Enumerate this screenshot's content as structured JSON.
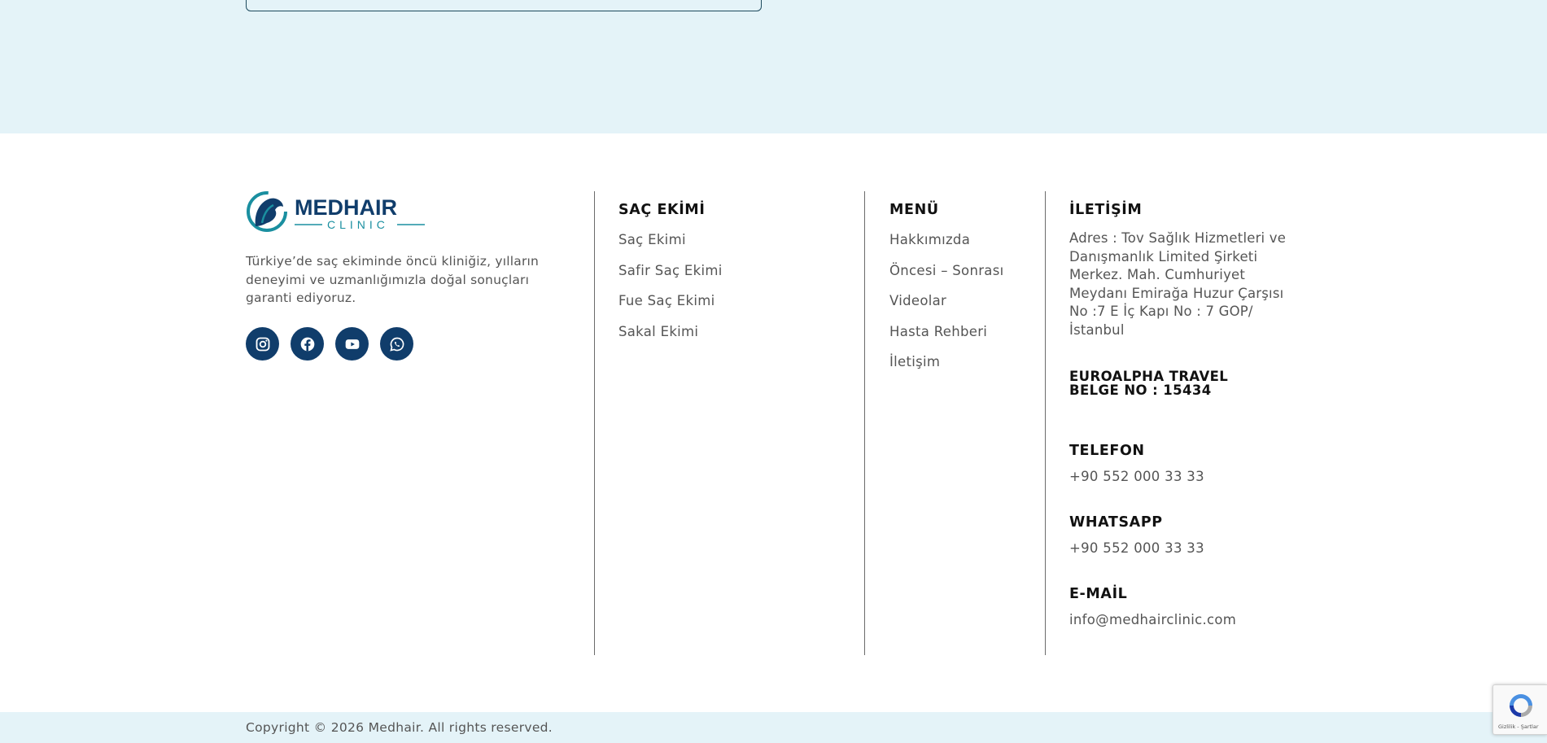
{
  "brand": {
    "name_top": "MEDHAIR",
    "name_bottom": "CLINIC",
    "tagline": "Türkiye’de saç ekiminde öncü kliniğiz, yılların deneyimi ve uzmanlığımızla doğal sonuçları garanti ediyoruz.",
    "accent_color": "#103d6b",
    "logo_teal": "#1a8fa0"
  },
  "socials": [
    {
      "name": "instagram",
      "icon": "instagram-icon"
    },
    {
      "name": "facebook",
      "icon": "facebook-icon"
    },
    {
      "name": "youtube",
      "icon": "youtube-icon"
    },
    {
      "name": "whatsapp",
      "icon": "whatsapp-icon"
    }
  ],
  "columns": {
    "hair": {
      "title": "SAÇ EKİMİ",
      "links": [
        "Saç Ekimi",
        "Safir Saç Ekimi",
        "Fue Saç Ekimi",
        "Sakal Ekimi"
      ]
    },
    "menu": {
      "title": "MENÜ",
      "links": [
        "Hakkımızda",
        "Öncesi – Sonrası",
        "Videolar",
        "Hasta Rehberi",
        "İletişim"
      ]
    }
  },
  "contact": {
    "title": "İLETİŞİM",
    "address": "Adres : Tov Sağlık Hizmetleri ve Danışmanlık Limited Şirketi Merkez. Mah. Cumhuriyet Meydanı Emirağa Huzur Çarşısı No :7 E İç Kapı No : 7 GOP/ İstanbul",
    "belge": "EUROALPHA TRAVEL BELGE NO : 15434",
    "phone_label": "TELEFON",
    "phone": "+90 552 000 33 33",
    "whatsapp_label": "WHATSAPP",
    "whatsapp": "+90 552 000 33 33",
    "email_label": "E-MAİL",
    "email": "info@medhairclinic.com"
  },
  "copyright": "Copyright © 2026 Medhair. All rights reserved.",
  "recaptcha": {
    "text": "Gizlilik - Şartlar"
  }
}
